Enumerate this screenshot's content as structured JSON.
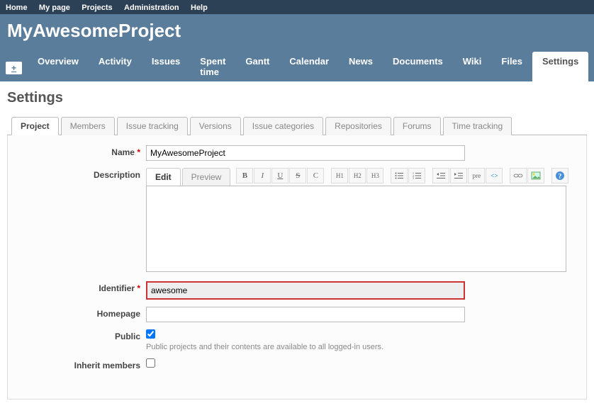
{
  "topMenu": {
    "home": "Home",
    "mypage": "My page",
    "projects": "Projects",
    "admin": "Administration",
    "help": "Help"
  },
  "header": {
    "title": "MyAwesomeProject"
  },
  "mainMenu": {
    "plus": "+",
    "tabs": [
      "Overview",
      "Activity",
      "Issues",
      "Spent time",
      "Gantt",
      "Calendar",
      "News",
      "Documents",
      "Wiki",
      "Files",
      "Settings"
    ],
    "selected": "Settings"
  },
  "page": {
    "title": "Settings"
  },
  "subTabs": {
    "items": [
      "Project",
      "Members",
      "Issue tracking",
      "Versions",
      "Issue categories",
      "Repositories",
      "Forums",
      "Time tracking"
    ],
    "active": "Project"
  },
  "form": {
    "name": {
      "label": "Name",
      "value": "MyAwesomeProject"
    },
    "description": {
      "label": "Description",
      "editTab": "Edit",
      "previewTab": "Preview",
      "value": ""
    },
    "identifier": {
      "label": "Identifier",
      "value": "awesome"
    },
    "homepage": {
      "label": "Homepage",
      "value": ""
    },
    "public": {
      "label": "Public",
      "hint": "Public projects and their contents are available to all logged-in users.",
      "checked": true
    },
    "inherit": {
      "label": "Inherit members",
      "checked": false
    }
  },
  "toolbar": {
    "bold": "B",
    "italic": "I",
    "underline": "U",
    "strike": "S",
    "code": "C",
    "h1": "H1",
    "h2": "H2",
    "h3": "H3",
    "pre": "pre"
  }
}
